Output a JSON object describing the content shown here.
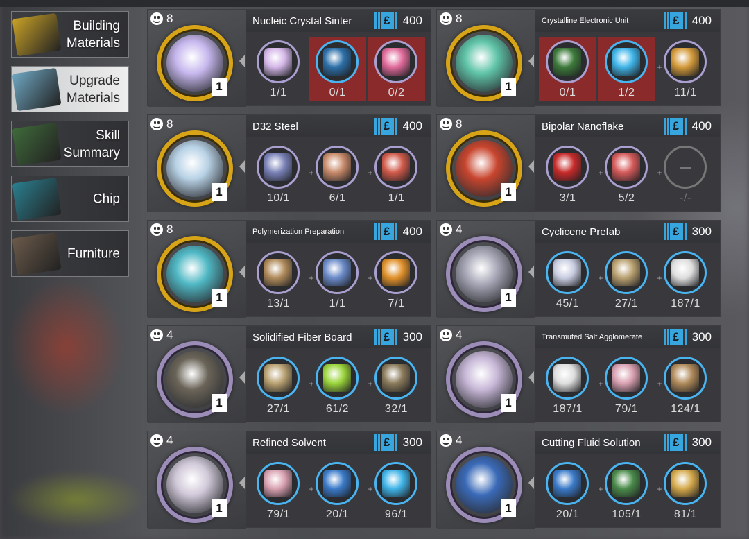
{
  "menu": [
    {
      "label": "Building\nMaterials",
      "active": false,
      "color": "#c9a227"
    },
    {
      "label": "Upgrade\nMaterials",
      "active": true,
      "color": "#6fa7c2"
    },
    {
      "label": "Skill\nSummary",
      "active": false,
      "color": "#3f6a3a"
    },
    {
      "label": "Chip",
      "active": false,
      "color": "#2a7f8f"
    },
    {
      "label": "Furniture",
      "active": false,
      "color": "#6b5a4a"
    }
  ],
  "recipes": [
    {
      "name": "Nucleic Crystal Sinter",
      "small": false,
      "level": "8",
      "cost": "400",
      "qty": "1",
      "ring": "gold",
      "art": "#c7b8ee",
      "materials": [
        {
          "count": "1/1",
          "short": false,
          "ring": "purple",
          "color": "#d4b6e8"
        },
        {
          "count": "0/1",
          "short": true,
          "ring": "blue",
          "color": "#2c6fa8"
        },
        {
          "count": "0/2",
          "short": true,
          "ring": "purple",
          "color": "#e06a9a"
        }
      ]
    },
    {
      "name": "Crystalline Electronic Unit",
      "small": true,
      "level": "8",
      "cost": "400",
      "qty": "1",
      "ring": "gold",
      "art": "#5fc4a8",
      "materials": [
        {
          "count": "0/1",
          "short": true,
          "ring": "purple",
          "color": "#3d7a3a"
        },
        {
          "count": "1/2",
          "short": true,
          "ring": "blue",
          "color": "#3fb4e8"
        },
        {
          "count": "11/1",
          "short": false,
          "ring": "purple",
          "color": "#d49a3a"
        }
      ]
    },
    {
      "name": "D32 Steel",
      "small": false,
      "level": "8",
      "cost": "400",
      "qty": "1",
      "ring": "gold",
      "art": "#b8d2e6",
      "materials": [
        {
          "count": "10/1",
          "short": false,
          "ring": "purple",
          "color": "#7a82b8"
        },
        {
          "count": "6/1",
          "short": false,
          "ring": "purple",
          "color": "#c88a6a"
        },
        {
          "count": "1/1",
          "short": false,
          "ring": "purple",
          "color": "#d05a4a"
        }
      ]
    },
    {
      "name": "Bipolar Nanoflake",
      "small": false,
      "level": "8",
      "cost": "400",
      "qty": "1",
      "ring": "gold",
      "art": "#c8452e",
      "materials": [
        {
          "count": "3/1",
          "short": false,
          "ring": "purple",
          "color": "#c82a2a"
        },
        {
          "count": "5/2",
          "short": false,
          "ring": "purple",
          "color": "#d45a5a"
        },
        {
          "count": "-/-",
          "short": false,
          "ring": "empty",
          "color": ""
        }
      ]
    },
    {
      "name": "Polymerization Preparation",
      "small": true,
      "level": "8",
      "cost": "400",
      "qty": "1",
      "ring": "gold",
      "art": "#4fb8c4",
      "materials": [
        {
          "count": "13/1",
          "short": false,
          "ring": "purple",
          "color": "#b08a5a"
        },
        {
          "count": "1/1",
          "short": false,
          "ring": "purple",
          "color": "#6a8ac8"
        },
        {
          "count": "7/1",
          "short": false,
          "ring": "purple",
          "color": "#e0902a"
        }
      ]
    },
    {
      "name": "Cyclicene Prefab",
      "small": false,
      "level": "4",
      "cost": "300",
      "qty": "1",
      "ring": "purple",
      "art": "#a8a8b8",
      "materials": [
        {
          "count": "45/1",
          "short": false,
          "ring": "blue",
          "color": "#c8cce0"
        },
        {
          "count": "27/1",
          "short": false,
          "ring": "blue",
          "color": "#b8a070"
        },
        {
          "count": "187/1",
          "short": false,
          "ring": "blue",
          "color": "#dedede"
        }
      ]
    },
    {
      "name": "Solidified Fiber Board",
      "small": false,
      "level": "4",
      "cost": "300",
      "qty": "1",
      "ring": "purple",
      "art": "#6a6458",
      "materials": [
        {
          "count": "27/1",
          "short": false,
          "ring": "blue",
          "color": "#b8a070"
        },
        {
          "count": "61/2",
          "short": false,
          "ring": "blue",
          "color": "#9ad43a"
        },
        {
          "count": "32/1",
          "short": false,
          "ring": "blue",
          "color": "#8a7a5a"
        }
      ]
    },
    {
      "name": "Transmuted Salt Agglomerate",
      "small": true,
      "level": "4",
      "cost": "300",
      "qty": "1",
      "ring": "purple",
      "art": "#c8b8d8",
      "materials": [
        {
          "count": "187/1",
          "short": false,
          "ring": "blue",
          "color": "#dedede"
        },
        {
          "count": "79/1",
          "short": false,
          "ring": "blue",
          "color": "#d8a0b0"
        },
        {
          "count": "124/1",
          "short": false,
          "ring": "blue",
          "color": "#b08a5a"
        }
      ]
    },
    {
      "name": "Refined Solvent",
      "small": false,
      "level": "4",
      "cost": "300",
      "qty": "1",
      "ring": "purple",
      "art": "#d0c8d8",
      "materials": [
        {
          "count": "79/1",
          "short": false,
          "ring": "blue",
          "color": "#d8a0b0"
        },
        {
          "count": "20/1",
          "short": false,
          "ring": "blue",
          "color": "#3a7ac8"
        },
        {
          "count": "96/1",
          "short": false,
          "ring": "blue",
          "color": "#3fb4e8"
        }
      ]
    },
    {
      "name": "Cutting Fluid Solution",
      "small": false,
      "level": "4",
      "cost": "300",
      "qty": "1",
      "ring": "purple",
      "art": "#3a6ab8",
      "materials": [
        {
          "count": "20/1",
          "short": false,
          "ring": "blue",
          "color": "#3a7ac8"
        },
        {
          "count": "105/1",
          "short": false,
          "ring": "blue",
          "color": "#4a8a4a"
        },
        {
          "count": "81/1",
          "short": false,
          "ring": "blue",
          "color": "#d4a84a"
        }
      ]
    }
  ],
  "cost_symbol": "£"
}
